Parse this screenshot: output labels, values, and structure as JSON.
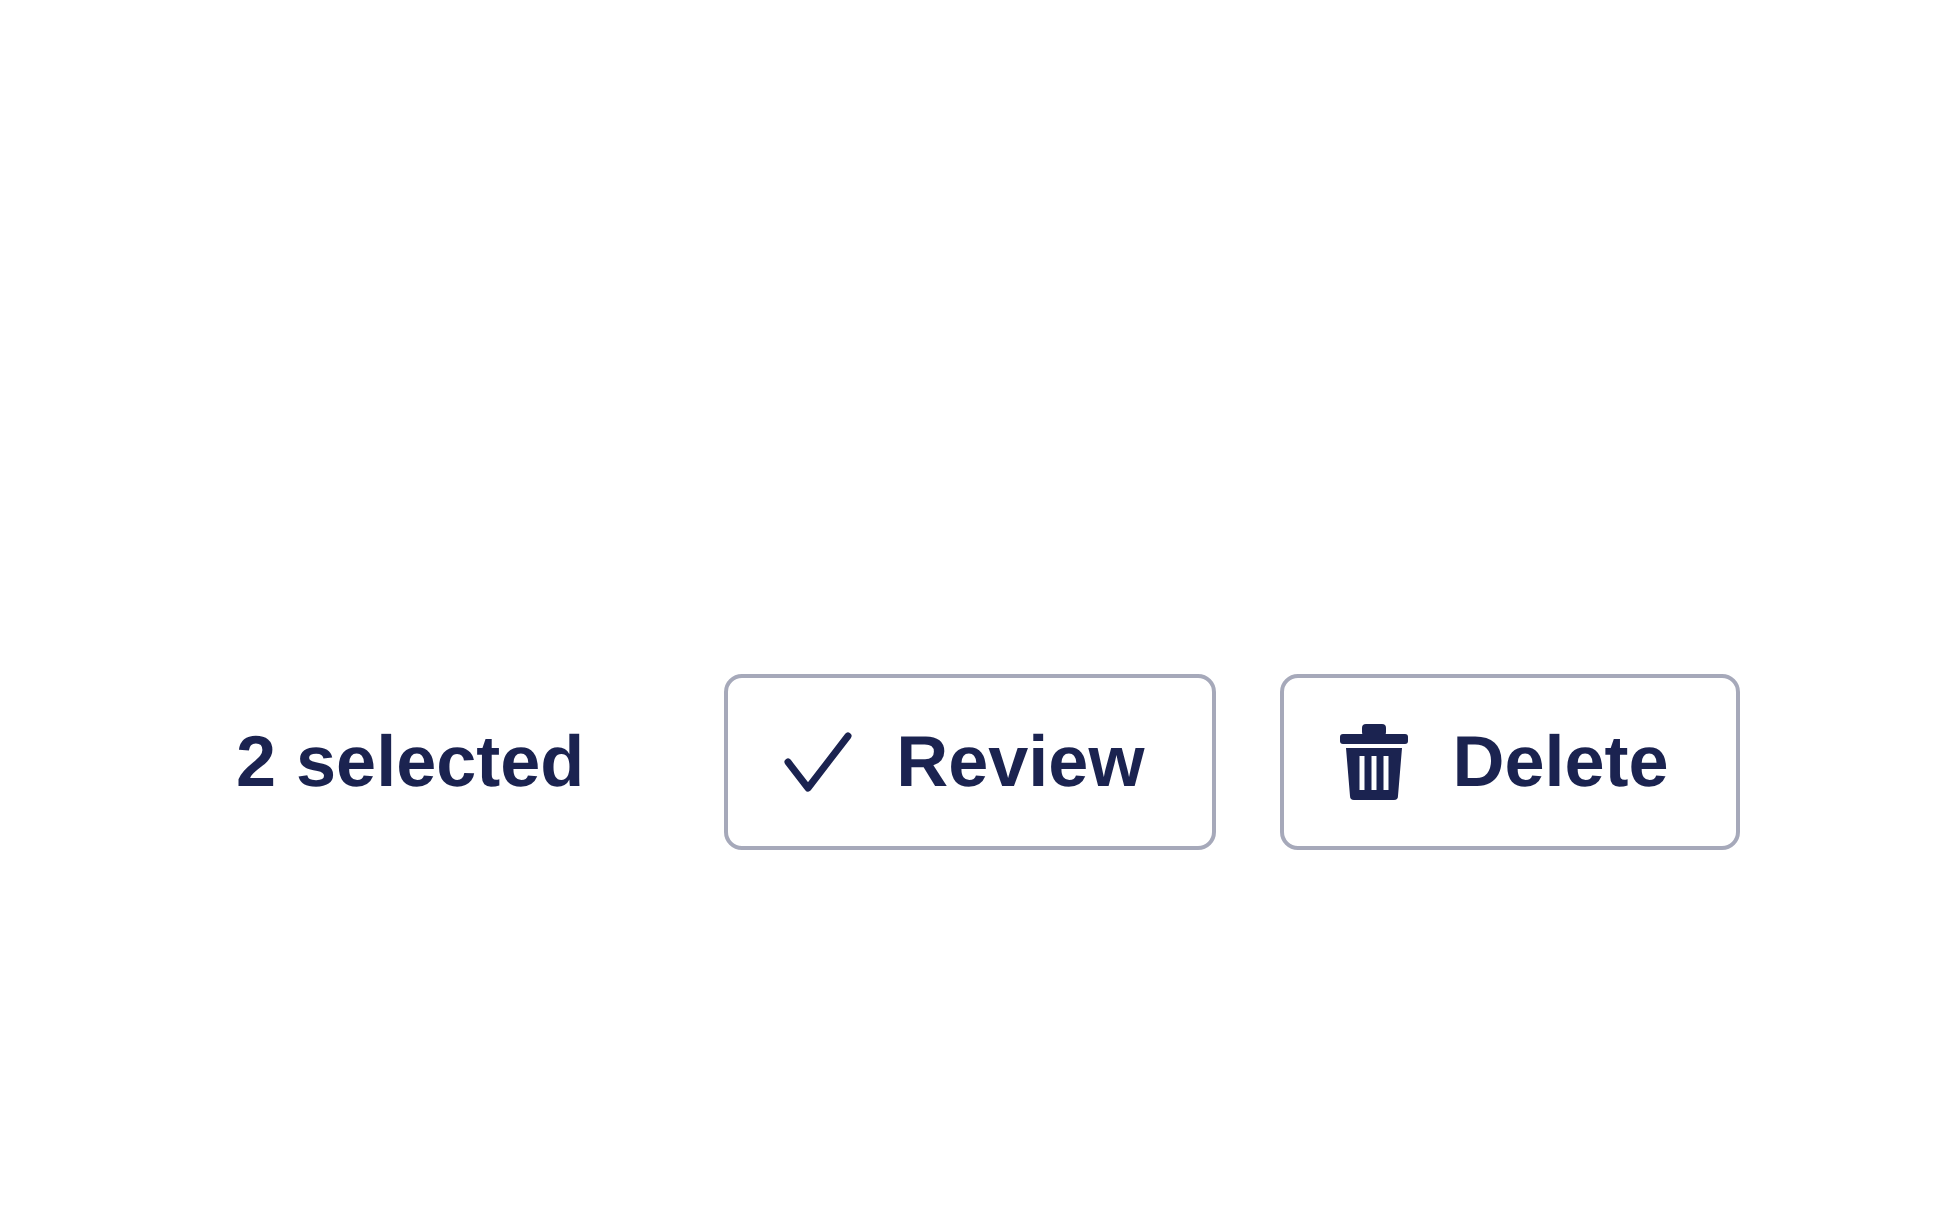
{
  "selection_count": "2 selected",
  "buttons": [
    {
      "label": "Review",
      "kind": "review"
    },
    {
      "label": "Delete",
      "kind": "delete"
    }
  ]
}
